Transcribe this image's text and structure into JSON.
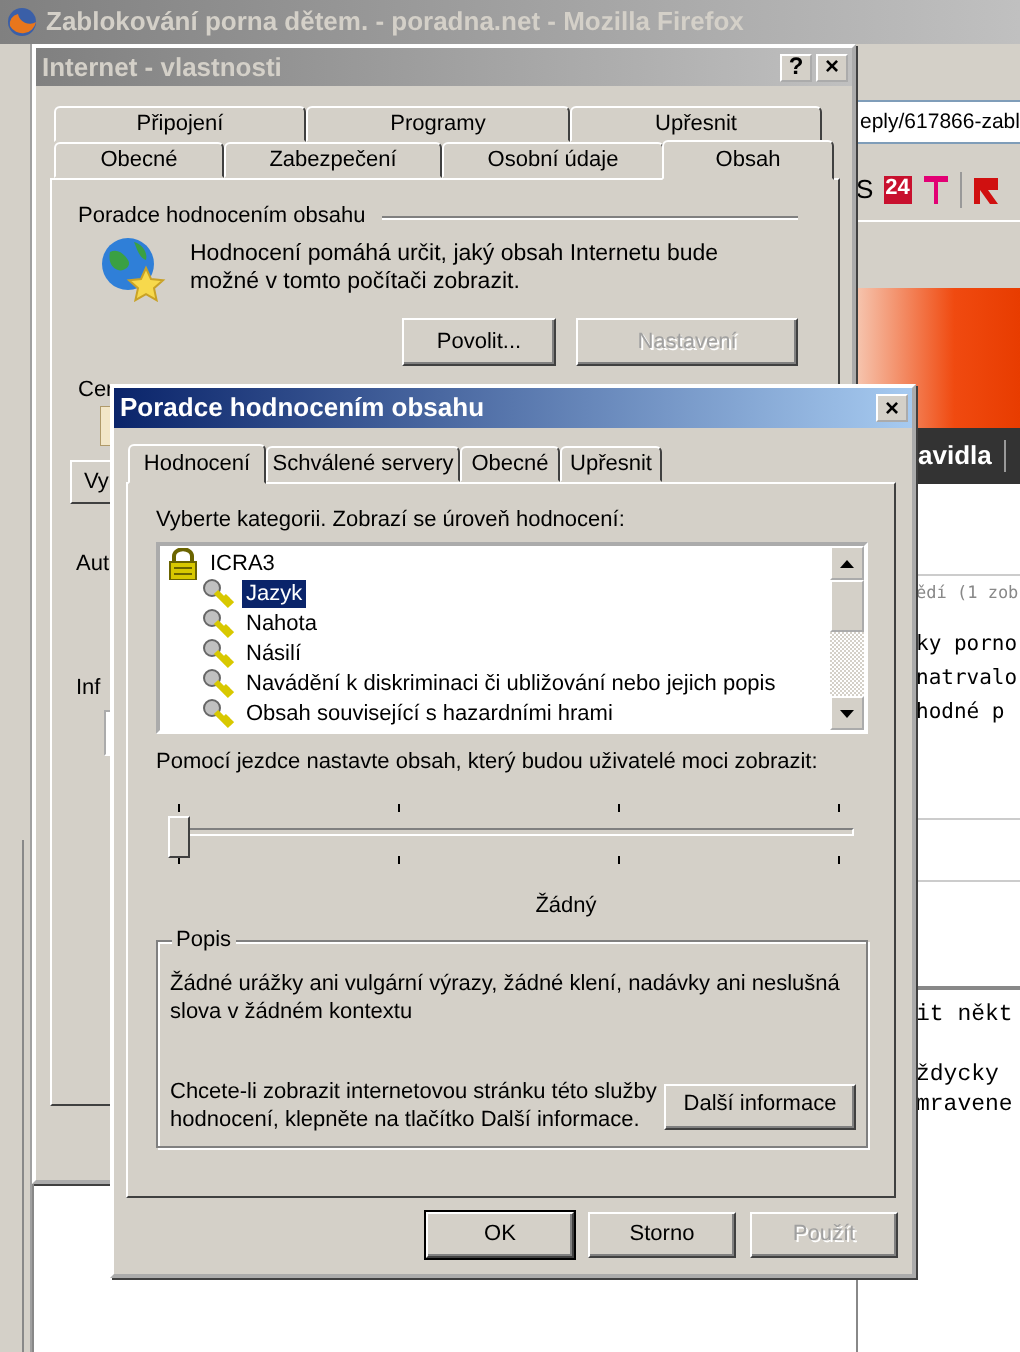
{
  "browser": {
    "title": "Zablokování porna dětem. - poradna.net - Mozilla Firefox",
    "url": "eply/617866-zabl",
    "bookmark_text": "S",
    "bookmark_logo": "24",
    "nav_text": "avidla",
    "page_lines": [
      "ědí (1 zob",
      "ky porno",
      "natrvalo",
      "hodné p"
    ],
    "mono_lines": [
      "it někt",
      "ždycky",
      "mravene"
    ]
  },
  "properties_window": {
    "title": "Internet - vlastnosti",
    "help": "?",
    "close": "×",
    "tab_rows": [
      [
        {
          "label": "Připojení",
          "selected": false
        },
        {
          "label": "Programy",
          "selected": false
        },
        {
          "label": "Upřesnit",
          "selected": false
        }
      ],
      [
        {
          "label": "Obecné",
          "selected": false
        },
        {
          "label": "Zabezpečení",
          "selected": false
        },
        {
          "label": "Osobní údaje",
          "selected": false
        },
        {
          "label": "Obsah",
          "selected": true
        }
      ]
    ],
    "group_title": "Poradce hodnocením obsahu",
    "description": "Hodnocení pomáhá určit, jaký obsah Internetu bude možné v tomto počítači zobrazit.",
    "buttons": [
      {
        "label": "Povolit...",
        "disabled": false
      },
      {
        "label": "Nastavení",
        "disabled": true
      }
    ],
    "cut_items": [
      {
        "kind": "label",
        "text": "Cer"
      },
      {
        "kind": "icon"
      },
      {
        "kind": "button",
        "text": "Vy"
      },
      {
        "kind": "label",
        "text": "Aut"
      },
      {
        "kind": "label",
        "text": "Inf"
      },
      {
        "kind": "field"
      }
    ]
  },
  "rating_dialog": {
    "title": "Poradce hodnocením obsahu",
    "close": "×",
    "tabs": [
      {
        "label": "Hodnocení",
        "selected": true
      },
      {
        "label": "Schválené servery",
        "selected": false
      },
      {
        "label": "Obecné",
        "selected": false
      },
      {
        "label": "Upřesnit",
        "selected": false
      }
    ],
    "list_label": "Vyberte kategorii. Zobrazí se úroveň hodnocení:",
    "tree": [
      {
        "label": "ICRA3",
        "expanded": true,
        "selected": false,
        "children": [
          {
            "label": "Jazyk",
            "selected": true
          },
          {
            "label": "Nahota",
            "selected": false
          },
          {
            "label": "Násilí",
            "selected": false
          },
          {
            "label": "Navádění k diskriminaci či ubližování nebo jejich popis",
            "selected": false
          },
          {
            "label": "Obsah související s hazardními hrami",
            "selected": false
          }
        ]
      }
    ],
    "slider_label": "Pomocí jezdce nastavte obsah, který budou uživatelé moci zobrazit:",
    "slider": {
      "level": 0
    },
    "level_name": "Žádný",
    "description_title": "Popis",
    "description": "Žádné urážky ani vulgární výrazy, žádné klení, nadávky ani neslušná slova v žádném kontextu",
    "info_text": "Chcete-li zobrazit internetovou stránku této služby hodnocení, klepněte na tlačítko Další informace.",
    "info_button": "Další informace",
    "buttons": [
      {
        "label": "OK",
        "default": true,
        "disabled": false
      },
      {
        "label": "Storno",
        "default": false,
        "disabled": false
      },
      {
        "label": "Použít",
        "default": false,
        "disabled": true
      }
    ]
  }
}
